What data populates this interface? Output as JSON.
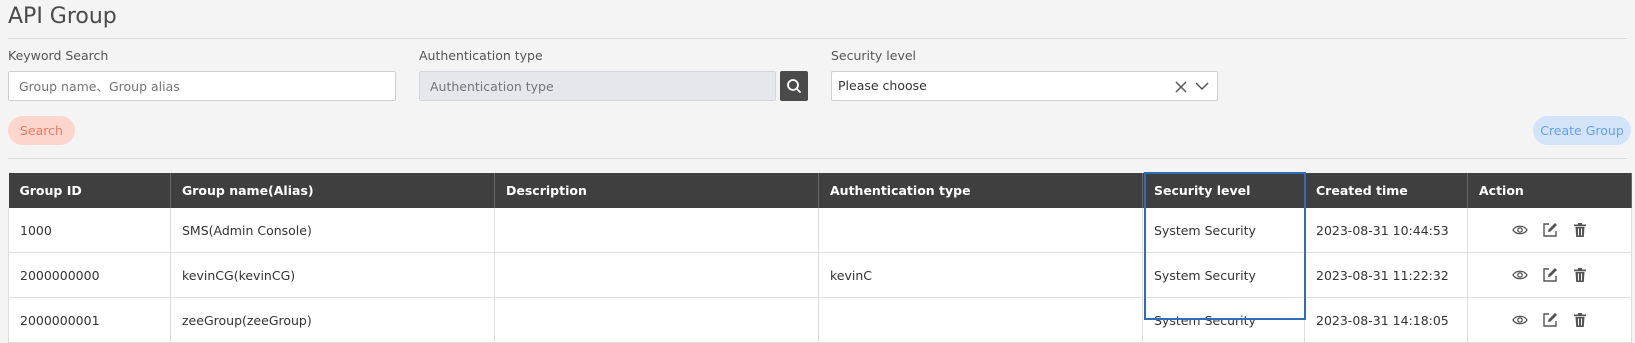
{
  "page": {
    "title": "API Group"
  },
  "filters": {
    "keyword": {
      "label": "Keyword Search",
      "placeholder": "Group name、Group alias"
    },
    "auth_type": {
      "label": "Authentication type",
      "placeholder": "Authentication type"
    },
    "security": {
      "label": "Security level",
      "value": "Please choose"
    }
  },
  "buttons": {
    "search": "Search",
    "create": "Create Group"
  },
  "table": {
    "headers": {
      "group_id": "Group ID",
      "group_name": "Group name(Alias)",
      "description": "Description",
      "auth_type": "Authentication type",
      "security_level": "Security level",
      "created_time": "Created time",
      "action": "Action"
    },
    "rows": [
      {
        "group_id": "1000",
        "group_name": "SMS(Admin Console)",
        "description": "",
        "auth_type": "",
        "security_level": "System Security",
        "created_time": "2023-08-31 10:44:53"
      },
      {
        "group_id": "2000000000",
        "group_name": "kevinCG(kevinCG)",
        "description": "",
        "auth_type": "kevinC",
        "security_level": "System Security",
        "created_time": "2023-08-31 11:22:32"
      },
      {
        "group_id": "2000000001",
        "group_name": "zeeGroup(zeeGroup)",
        "description": "",
        "auth_type": "",
        "security_level": "System Security",
        "created_time": "2023-08-31 14:18:05"
      }
    ]
  },
  "icons": [
    "search-icon",
    "clear-icon",
    "chevron-down-icon",
    "view-icon",
    "edit-icon",
    "delete-icon"
  ],
  "colors": {
    "header_bg": "#3f3f3f",
    "search_pill_bg": "#fcd6cd",
    "search_pill_text": "#e87b63",
    "create_pill_bg": "#d3e4f9",
    "create_pill_text": "#6a9ee6",
    "highlight_border": "#2f6db8"
  }
}
